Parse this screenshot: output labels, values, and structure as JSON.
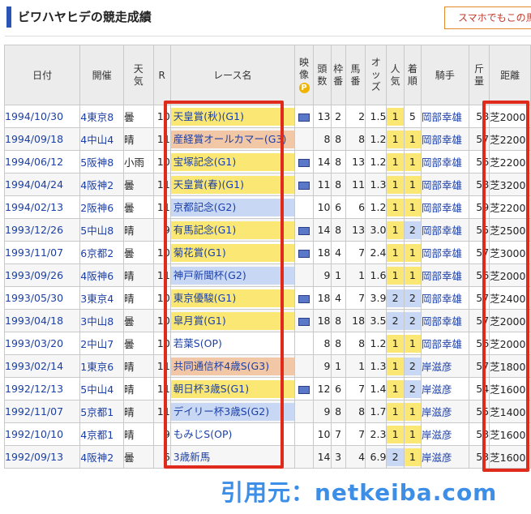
{
  "page": {
    "title": "ビワハヤヒデの競走成績",
    "sp_link": "スマホでもこの馬",
    "credit": "引用元：netkeiba.com"
  },
  "table": {
    "headers": {
      "date": "日付",
      "venue": "開催",
      "weather": [
        "天",
        "気"
      ],
      "r": "R",
      "race": "レース名",
      "video": [
        "映",
        "像"
      ],
      "video_icon": "P",
      "heads": [
        "頭",
        "数"
      ],
      "waku": [
        "枠",
        "番"
      ],
      "umaban": [
        "馬",
        "番"
      ],
      "odds": [
        "オ",
        "ッ",
        "ズ"
      ],
      "ninki": [
        "人",
        "気"
      ],
      "chaku": [
        "着",
        "順"
      ],
      "jockey": "騎手",
      "kinryo": [
        "斤",
        "量"
      ],
      "dist": "距離"
    },
    "rows": [
      {
        "date": "1994/10/30",
        "venue": "4東京8",
        "weather": "曇",
        "r": "10",
        "race": "天皇賞(秋)(G1)",
        "grade": "g1",
        "video": true,
        "heads": "13",
        "waku": "2",
        "umaban": "2",
        "odds": "1.5",
        "ninki": "1",
        "chaku": "5",
        "jockey": "岡部幸雄",
        "kinryo": "58",
        "dist": "芝2000"
      },
      {
        "date": "1994/09/18",
        "venue": "4中山4",
        "weather": "晴",
        "r": "11",
        "race": "産経賞オールカマー(G3)",
        "grade": "g3",
        "video": false,
        "heads": "8",
        "waku": "8",
        "umaban": "8",
        "odds": "1.2",
        "ninki": "1",
        "chaku": "1",
        "jockey": "岡部幸雄",
        "kinryo": "57",
        "dist": "芝2200"
      },
      {
        "date": "1994/06/12",
        "venue": "5阪神8",
        "weather": "小雨",
        "r": "10",
        "race": "宝塚記念(G1)",
        "grade": "g1",
        "video": true,
        "heads": "14",
        "waku": "8",
        "umaban": "13",
        "odds": "1.2",
        "ninki": "1",
        "chaku": "1",
        "jockey": "岡部幸雄",
        "kinryo": "56",
        "dist": "芝2200"
      },
      {
        "date": "1994/04/24",
        "venue": "4阪神2",
        "weather": "曇",
        "r": "11",
        "race": "天皇賞(春)(G1)",
        "grade": "g1",
        "video": true,
        "heads": "11",
        "waku": "8",
        "umaban": "11",
        "odds": "1.3",
        "ninki": "1",
        "chaku": "1",
        "jockey": "岡部幸雄",
        "kinryo": "58",
        "dist": "芝3200"
      },
      {
        "date": "1994/02/13",
        "venue": "2阪神6",
        "weather": "曇",
        "r": "11",
        "race": "京都記念(G2)",
        "grade": "g2",
        "video": false,
        "heads": "10",
        "waku": "6",
        "umaban": "6",
        "odds": "1.2",
        "ninki": "1",
        "chaku": "1",
        "jockey": "岡部幸雄",
        "kinryo": "59",
        "dist": "芝2200"
      },
      {
        "date": "1993/12/26",
        "venue": "5中山8",
        "weather": "晴",
        "r": "9",
        "race": "有馬記念(G1)",
        "grade": "g1",
        "video": true,
        "heads": "14",
        "waku": "8",
        "umaban": "13",
        "odds": "3.0",
        "ninki": "1",
        "chaku": "2",
        "jockey": "岡部幸雄",
        "kinryo": "55",
        "dist": "芝2500"
      },
      {
        "date": "1993/11/07",
        "venue": "6京都2",
        "weather": "曇",
        "r": "10",
        "race": "菊花賞(G1)",
        "grade": "g1",
        "video": true,
        "heads": "18",
        "waku": "4",
        "umaban": "7",
        "odds": "2.4",
        "ninki": "1",
        "chaku": "1",
        "jockey": "岡部幸雄",
        "kinryo": "57",
        "dist": "芝3000"
      },
      {
        "date": "1993/09/26",
        "venue": "4阪神6",
        "weather": "晴",
        "r": "11",
        "race": "神戸新聞杯(G2)",
        "grade": "g2",
        "video": false,
        "heads": "9",
        "waku": "1",
        "umaban": "1",
        "odds": "1.6",
        "ninki": "1",
        "chaku": "1",
        "jockey": "岡部幸雄",
        "kinryo": "56",
        "dist": "芝2000"
      },
      {
        "date": "1993/05/30",
        "venue": "3東京4",
        "weather": "晴",
        "r": "10",
        "race": "東京優駿(G1)",
        "grade": "g1",
        "video": true,
        "heads": "18",
        "waku": "4",
        "umaban": "7",
        "odds": "3.9",
        "ninki": "2",
        "chaku": "2",
        "jockey": "岡部幸雄",
        "kinryo": "57",
        "dist": "芝2400"
      },
      {
        "date": "1993/04/18",
        "venue": "3中山8",
        "weather": "曇",
        "r": "10",
        "race": "皐月賞(G1)",
        "grade": "g1",
        "video": true,
        "heads": "18",
        "waku": "8",
        "umaban": "18",
        "odds": "3.5",
        "ninki": "2",
        "chaku": "2",
        "jockey": "岡部幸雄",
        "kinryo": "57",
        "dist": "芝2000"
      },
      {
        "date": "1993/03/20",
        "venue": "2中山7",
        "weather": "曇",
        "r": "10",
        "race": "若葉S(OP)",
        "grade": "op",
        "video": false,
        "heads": "8",
        "waku": "8",
        "umaban": "8",
        "odds": "1.2",
        "ninki": "1",
        "chaku": "1",
        "jockey": "岡部幸雄",
        "kinryo": "56",
        "dist": "芝2000"
      },
      {
        "date": "1993/02/14",
        "venue": "1東京6",
        "weather": "晴",
        "r": "11",
        "race": "共同通信杯4歳S(G3)",
        "grade": "g3",
        "video": false,
        "heads": "9",
        "waku": "1",
        "umaban": "1",
        "odds": "1.3",
        "ninki": "1",
        "chaku": "2",
        "jockey": "岸滋彦",
        "kinryo": "57",
        "dist": "芝1800"
      },
      {
        "date": "1992/12/13",
        "venue": "5中山4",
        "weather": "晴",
        "r": "11",
        "race": "朝日杯3歳S(G1)",
        "grade": "g1",
        "video": true,
        "heads": "12",
        "waku": "6",
        "umaban": "7",
        "odds": "1.4",
        "ninki": "1",
        "chaku": "2",
        "jockey": "岸滋彦",
        "kinryo": "54",
        "dist": "芝1600"
      },
      {
        "date": "1992/11/07",
        "venue": "5京都1",
        "weather": "晴",
        "r": "11",
        "race": "デイリー杯3歳S(G2)",
        "grade": "g2",
        "video": false,
        "heads": "9",
        "waku": "8",
        "umaban": "8",
        "odds": "1.7",
        "ninki": "1",
        "chaku": "1",
        "jockey": "岸滋彦",
        "kinryo": "55",
        "dist": "芝1400"
      },
      {
        "date": "1992/10/10",
        "venue": "4京都1",
        "weather": "晴",
        "r": "9",
        "race": "もみじS(OP)",
        "grade": "op",
        "video": false,
        "heads": "10",
        "waku": "7",
        "umaban": "7",
        "odds": "2.3",
        "ninki": "1",
        "chaku": "1",
        "jockey": "岸滋彦",
        "kinryo": "53",
        "dist": "芝1600"
      },
      {
        "date": "1992/09/13",
        "venue": "4阪神2",
        "weather": "曇",
        "r": "6",
        "race": "3歳新馬",
        "grade": "op",
        "video": false,
        "heads": "14",
        "waku": "3",
        "umaban": "4",
        "odds": "6.9",
        "ninki": "2",
        "chaku": "1",
        "jockey": "岸滋彦",
        "kinryo": "53",
        "dist": "芝1600"
      }
    ]
  }
}
